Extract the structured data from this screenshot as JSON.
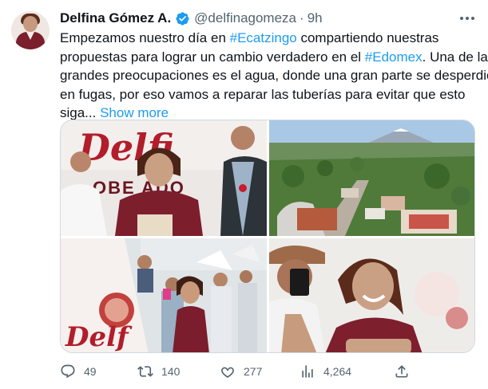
{
  "author": {
    "name": "Delfina Gómez A.",
    "handle": "@delfinagomeza",
    "separator": "·",
    "time": "9h",
    "verified_icon": "verified-badge-icon"
  },
  "tweet": {
    "line1_pre": "Empezamos nuestro día en ",
    "line1_tag": "#Ecatzingo",
    "line1_post": " compartiendo nuestras",
    "line2_pre": "propuestas para lograr un cambio verdadero en el ",
    "line2_tag": "#Edomex",
    "line2_post": ". Una de las",
    "line3": "grandes preocupaciones es el agua, donde una gran parte se desperdicia",
    "line4": "en fugas, por eso vamos a reparar las tuberías para evitar que esto",
    "line5": "siga... ",
    "show_more": "Show more"
  },
  "media": {
    "photo1_sign_text": "Delfi",
    "photo1_sign_text2": "OBE ADO",
    "photo3_flag_text": "Delf"
  },
  "actions": {
    "replies": "49",
    "retweets": "140",
    "likes": "277",
    "views": "4,264"
  },
  "colors": {
    "accent": "#1d9bf0",
    "muted": "#536471",
    "text": "#0f1419",
    "brand_maroon": "#8b1a2b"
  }
}
